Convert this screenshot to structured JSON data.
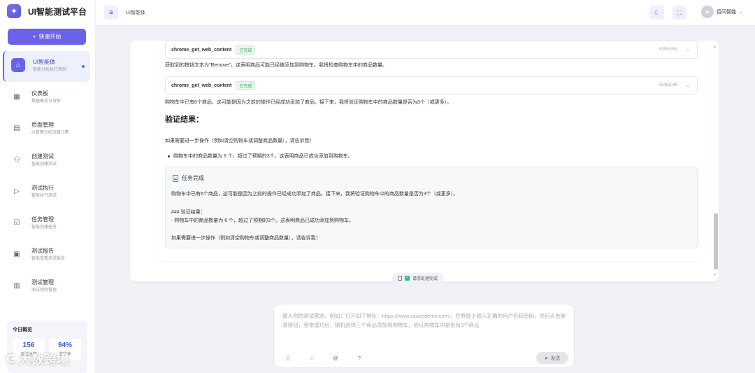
{
  "app": {
    "title": "UI智能测试平台",
    "logo_icon": "star-logo"
  },
  "sidebar": {
    "quick_start": "快速开始",
    "items": [
      {
        "label": "UI智能体",
        "sub": "智能分析执行用例",
        "icon": "robot-icon",
        "active": true
      },
      {
        "label": "仪表板",
        "sub": "数据概览与分析",
        "icon": "dashboard-icon"
      },
      {
        "label": "页面管理",
        "sub": "AI管理分析页面元素",
        "icon": "page-icon"
      },
      {
        "label": "创建测试",
        "sub": "智能创建测试",
        "icon": "create-icon"
      },
      {
        "label": "测试执行",
        "sub": "智能执行测试",
        "icon": "play-icon"
      },
      {
        "label": "任务管理",
        "sub": "智能创建任务",
        "icon": "task-icon"
      },
      {
        "label": "测试报告",
        "sub": "智能查看测试报告",
        "icon": "report-icon"
      },
      {
        "label": "测试管理",
        "sub": "测试用例管理",
        "icon": "manage-icon"
      }
    ],
    "overview": {
      "title": "今日概览",
      "stats": [
        {
          "value": "156",
          "label": "测试总数"
        },
        {
          "value": "94%",
          "label": "成功率"
        }
      ]
    },
    "watermark": "大数跨境"
  },
  "header": {
    "breadcrumb": "UI智能体",
    "user_name": "佰问智能"
  },
  "chat": {
    "tool_calls": [
      {
        "name": "chrome_get_web_content",
        "status": "已完成",
        "id": "5359c85d"
      },
      {
        "name": "chrome_get_web_content",
        "status": "已完成",
        "id": "55453046"
      }
    ],
    "para1": "获取到的按钮文本为\"Remove\"，这表明商品可能已经被添加到购物车。我将检查购物车中的商品数量。",
    "para2": "购物车中已有6个商品，这可能是因为之前的操作已经成功添加了商品。接下来，我将验证购物车中的商品数量是否为3个（或更多）。",
    "result_heading": "验证结果：",
    "para3": "如果需要进一步操作（例如清空购物车或调整商品数量），请告诉我！",
    "bullet": "购物车中的商品数量为 6 个，超过了预期的3个。这表明商品已成功添加到购物车。",
    "task_box": {
      "title": "任务完成",
      "line1": "购物车中已有6个商品，这可能是因为之前的操作已经成功添加了商品。接下来，我将验证购物车中的商品数量是否为3个（或更多）。",
      "line2": "### 验证结果：",
      "line3": "- 购物车中的商品数量为 6 个，超过了预期的3个。这表明商品已成功添加到购物车。",
      "line4": "如果需要进一步操作（例如清空购物车或调整商品数量），请告诉我！"
    },
    "status": "请求处理完成"
  },
  "composer": {
    "placeholder": "输入你的测试需求，例如：打开如下地址：https://www.saucedemo.com/，在界面上输入正确的用户名和密码，然后点击登录按钮，登录成功后，随机选择三个商品添加到购物车，验证购物车中是否有3个商品",
    "send_label": "发送",
    "tools": [
      "document-icon",
      "emoji-icon",
      "at-icon",
      "help-icon"
    ]
  },
  "colors": {
    "accent": "#6a63e8",
    "success": "#3fa35a",
    "stat_value": "#3b5bdb"
  }
}
